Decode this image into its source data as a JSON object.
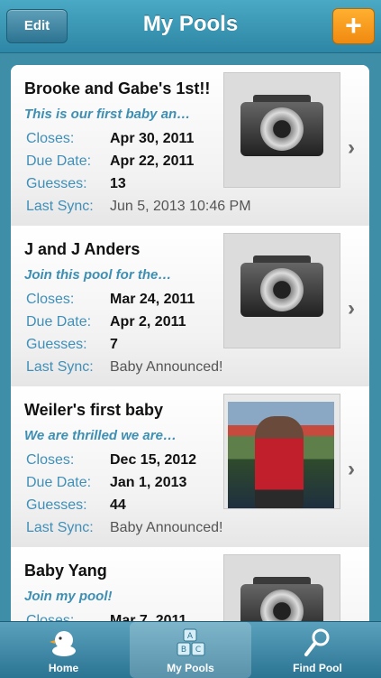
{
  "navbar": {
    "title": "My Pools",
    "edit_label": "Edit",
    "add_label": "+"
  },
  "pools": [
    {
      "title": "Brooke and Gabe's 1st!!",
      "description": "This is our first baby an…",
      "closes_label": "Closes:",
      "closes": "Apr 30, 2011",
      "due_label": "Due Date:",
      "due": "Apr 22, 2011",
      "guesses_label": "Guesses:",
      "guesses": "13",
      "sync_label": "Last Sync:",
      "sync": "Jun 5, 2013 10:46 PM",
      "image": "camera-icon"
    },
    {
      "title": "J and J Anders",
      "description": "Join this pool for the…",
      "closes_label": "Closes:",
      "closes": "Mar 24, 2011",
      "due_label": "Due Date:",
      "due": "Apr 2, 2011",
      "guesses_label": "Guesses:",
      "guesses": "7",
      "sync_label": "Last Sync:",
      "sync": "Baby Announced!",
      "image": "camera-icon"
    },
    {
      "title": "Weiler's first baby",
      "description": "We are thrilled we are…",
      "closes_label": "Closes:",
      "closes": "Dec 15, 2012",
      "due_label": "Due Date:",
      "due": "Jan 1, 2013",
      "guesses_label": "Guesses:",
      "guesses": "44",
      "sync_label": "Last Sync:",
      "sync": "Baby Announced!",
      "image": "photo"
    },
    {
      "title": "Baby Yang",
      "description": "Join my pool!",
      "closes_label": "Closes:",
      "closes": "Mar 7, 2011",
      "image": "camera-icon"
    }
  ],
  "tabs": [
    {
      "label": "Home",
      "icon": "duck-icon",
      "selected": false
    },
    {
      "label": "My Pools",
      "icon": "blocks-icon",
      "selected": true
    },
    {
      "label": "Find Pool",
      "icon": "rattle-icon",
      "selected": false
    }
  ],
  "colors": {
    "accent": "#3d8fb3",
    "nav": "#2d86a5",
    "add_button": "#f08a10"
  }
}
